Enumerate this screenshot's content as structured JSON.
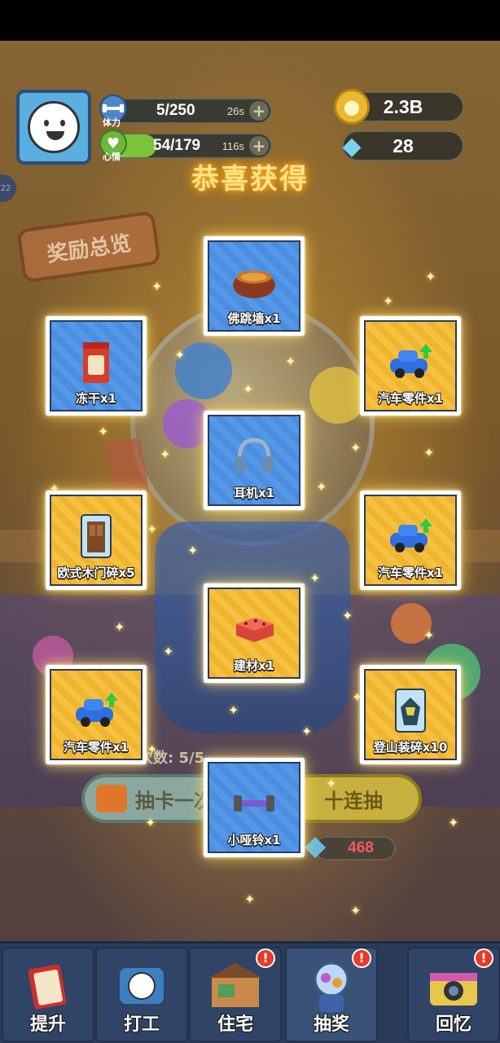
{
  "hud": {
    "stamina": {
      "label": "体力",
      "value": "5/250",
      "timer": "26s",
      "fill": 0.02
    },
    "mood": {
      "label": "心情",
      "value": "54/179",
      "timer": "116s",
      "fill": 0.3
    },
    "coins": "2.3B",
    "gems": "28",
    "side_tab": "22"
  },
  "overlay": {
    "title": "恭喜获得"
  },
  "background": {
    "overview_sign": "奖励总览",
    "draw_count_label": "次数: 5/5",
    "draw_one_label": "抽卡一次",
    "draw_ten_label": "十连抽",
    "gem_cost": "468"
  },
  "rewards": [
    {
      "label": "佛跳墙x1",
      "tier": "blue",
      "icon": "pot-icon"
    },
    {
      "label": "冻干x1",
      "tier": "blue",
      "icon": "snack-bag-icon"
    },
    {
      "label": "汽车零件x1",
      "tier": "gold",
      "icon": "car-part-icon"
    },
    {
      "label": "耳机x1",
      "tier": "blue",
      "icon": "headphones-icon"
    },
    {
      "label": "欧式木门碎x5",
      "tier": "gold",
      "icon": "door-fragment-icon"
    },
    {
      "label": "汽车零件x1",
      "tier": "gold",
      "icon": "car-part-icon"
    },
    {
      "label": "建材x1",
      "tier": "gold",
      "icon": "brick-icon"
    },
    {
      "label": "汽车零件x1",
      "tier": "gold",
      "icon": "car-part-icon"
    },
    {
      "label": "登山装碎x10",
      "tier": "gold",
      "icon": "climbing-gear-fragment-icon"
    },
    {
      "label": "小哑铃x1",
      "tier": "blue",
      "icon": "dumbbell-icon"
    }
  ],
  "nav": [
    {
      "label": "提升",
      "badge": "",
      "icon": "book-icon"
    },
    {
      "label": "打工",
      "badge": "",
      "icon": "work-tv-icon"
    },
    {
      "label": "住宅",
      "badge": "!",
      "icon": "house-icon"
    },
    {
      "label": "抽奖",
      "badge": "!",
      "icon": "gacha-machine-icon"
    },
    {
      "label": "回忆",
      "badge": "!",
      "icon": "camera-icon"
    }
  ],
  "colors": {
    "blue_card": "#4b8ee0",
    "gold_card": "#f0b52e",
    "title_glow": "#ffb020",
    "badge": "#e83a2c"
  }
}
